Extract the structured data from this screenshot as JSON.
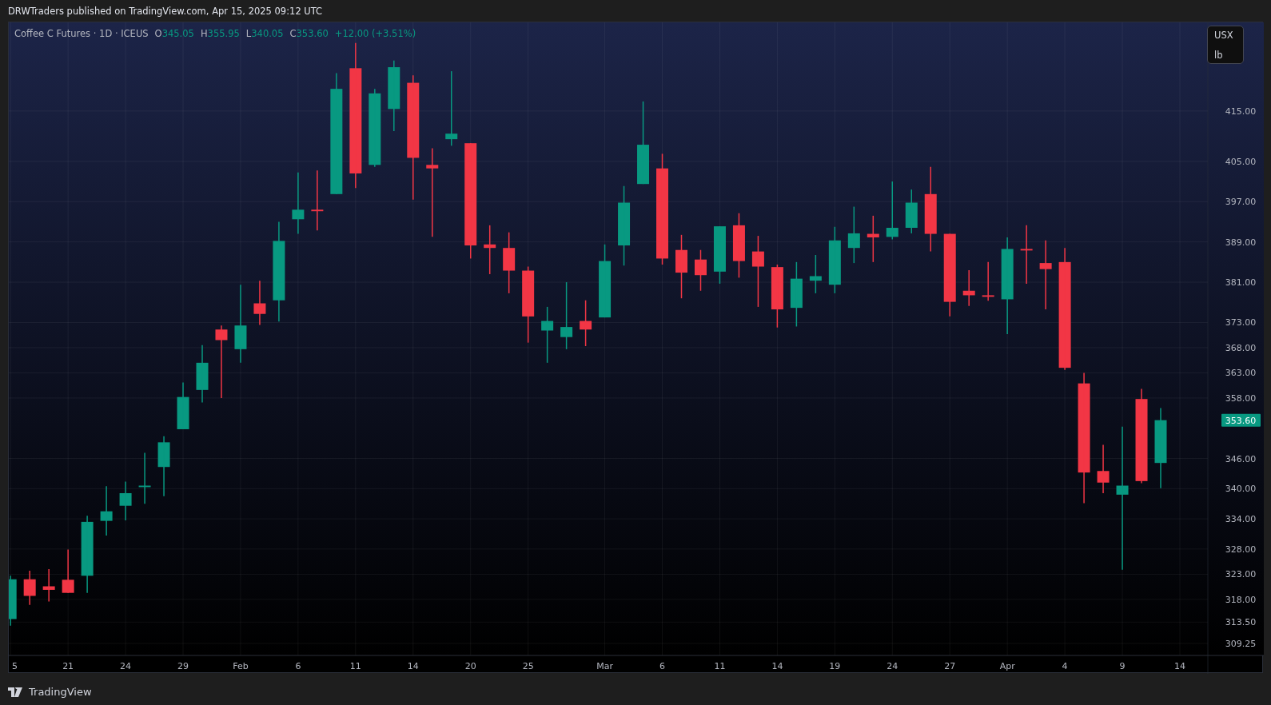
{
  "header": {
    "title": "DRWTraders published on TradingView.com, Apr 15, 2025 09:12 UTC"
  },
  "legend": {
    "symbol": "Coffee C Futures · 1D · ICEUS",
    "ohlc": [
      {
        "label": "O",
        "value": "345.05"
      },
      {
        "label": "H",
        "value": "355.95"
      },
      {
        "label": "L",
        "value": "340.05"
      },
      {
        "label": "C",
        "value": "353.60"
      }
    ],
    "change": "+12.00 (+3.51%)"
  },
  "units": [
    "USX",
    "lb"
  ],
  "last_price": "353.60",
  "chart": {
    "chart_data": {
      "type": "candlestick",
      "grid": true,
      "ylim": [
        306.87,
        432.6
      ],
      "categories": [
        "5",
        null,
        null,
        "21",
        null,
        null,
        "24",
        null,
        null,
        "29",
        null,
        null,
        "Feb",
        null,
        null,
        "6",
        null,
        null,
        "11",
        null,
        null,
        "14",
        null,
        null,
        "20",
        null,
        null,
        "25",
        null,
        null,
        null,
        "Mar",
        null,
        null,
        "6",
        null,
        null,
        "11",
        null,
        null,
        "14",
        null,
        null,
        "19",
        null,
        null,
        "24",
        null,
        null,
        "27",
        null,
        null,
        "Apr",
        null,
        null,
        "4",
        null,
        null,
        "9",
        null,
        null,
        "14"
      ],
      "yticks": [
        {
          "value": 415,
          "label": "415.00"
        },
        {
          "value": 405,
          "label": "405.00"
        },
        {
          "value": 397,
          "label": "397.00"
        },
        {
          "value": 389,
          "label": "389.00"
        },
        {
          "value": 381,
          "label": "381.00"
        },
        {
          "value": 373,
          "label": "373.00"
        },
        {
          "value": 368,
          "label": "368.00"
        },
        {
          "value": 363,
          "label": "363.00"
        },
        {
          "value": 358,
          "label": "358.00"
        },
        {
          "value": 346,
          "label": "346.00"
        },
        {
          "value": 340,
          "label": "340.00"
        },
        {
          "value": 334,
          "label": "334.00"
        },
        {
          "value": 328,
          "label": "328.00"
        },
        {
          "value": 323,
          "label": "323.00"
        },
        {
          "value": 318,
          "label": "318.00"
        },
        {
          "value": 313.5,
          "label": "313.50"
        },
        {
          "value": 309.25,
          "label": "309.25"
        }
      ],
      "ohlc": [
        [
          314.1,
          322.7,
          312.8,
          322.0
        ],
        [
          322.0,
          323.7,
          316.9,
          318.7
        ],
        [
          320.6,
          324.0,
          317.6,
          319.9
        ],
        [
          321.9,
          327.9,
          319.3,
          319.3
        ],
        [
          322.7,
          334.6,
          319.3,
          333.4
        ],
        [
          333.6,
          340.5,
          330.7,
          335.5
        ],
        [
          336.6,
          341.4,
          333.7,
          339.1
        ],
        [
          340.3,
          347.1,
          337.0,
          340.6
        ],
        [
          344.3,
          350.4,
          338.5,
          349.2
        ],
        [
          351.8,
          361.1,
          351.8,
          358.2
        ],
        [
          359.6,
          368.5,
          357.1,
          365.0
        ],
        [
          371.6,
          372.4,
          358.0,
          369.5
        ],
        [
          367.7,
          380.5,
          365.0,
          372.4
        ],
        [
          376.8,
          381.3,
          372.5,
          374.7
        ],
        [
          377.4,
          393.0,
          373.2,
          389.2
        ],
        [
          393.5,
          402.8,
          390.6,
          395.4
        ],
        [
          395.4,
          403.2,
          391.3,
          395.1
        ],
        [
          398.5,
          422.5,
          398.5,
          419.4
        ],
        [
          423.5,
          428.5,
          399.7,
          402.6
        ],
        [
          404.3,
          419.4,
          403.9,
          418.5
        ],
        [
          415.4,
          425.0,
          411.0,
          423.7
        ],
        [
          420.6,
          422.1,
          397.4,
          405.7
        ],
        [
          404.3,
          407.6,
          390.0,
          403.6
        ],
        [
          409.4,
          422.9,
          408.1,
          410.5
        ],
        [
          408.6,
          408.6,
          385.7,
          388.3
        ],
        [
          388.5,
          392.3,
          382.6,
          387.8
        ],
        [
          387.8,
          390.9,
          378.8,
          383.3
        ],
        [
          383.3,
          384.1,
          369.0,
          374.2
        ],
        [
          371.4,
          376.1,
          365.0,
          373.3
        ],
        [
          370.1,
          381.0,
          367.7,
          372.1
        ],
        [
          373.3,
          377.4,
          368.3,
          371.6
        ],
        [
          374.0,
          388.5,
          374.0,
          385.2
        ],
        [
          388.3,
          400.1,
          384.3,
          396.8
        ],
        [
          400.5,
          416.9,
          400.5,
          408.3
        ],
        [
          403.6,
          406.5,
          384.5,
          385.7
        ],
        [
          387.4,
          390.4,
          377.8,
          382.9
        ],
        [
          385.5,
          387.4,
          379.3,
          382.4
        ],
        [
          383.1,
          392.1,
          380.7,
          392.1
        ],
        [
          392.3,
          394.7,
          381.9,
          385.2
        ],
        [
          387.1,
          390.2,
          376.1,
          384.1
        ],
        [
          384.0,
          384.5,
          372.0,
          375.6
        ],
        [
          375.9,
          385.0,
          372.2,
          381.7
        ],
        [
          381.3,
          386.4,
          378.8,
          382.2
        ],
        [
          380.5,
          392.0,
          378.8,
          389.3
        ],
        [
          387.8,
          396.0,
          384.8,
          390.7
        ],
        [
          390.6,
          394.2,
          385.0,
          389.9
        ],
        [
          390.0,
          401.0,
          389.5,
          391.8
        ],
        [
          391.8,
          399.4,
          390.7,
          396.8
        ],
        [
          398.5,
          403.9,
          387.1,
          390.6
        ],
        [
          390.6,
          390.6,
          374.2,
          377.1
        ],
        [
          379.3,
          383.4,
          376.3,
          378.4
        ],
        [
          378.4,
          385.0,
          377.3,
          378.1
        ],
        [
          377.6,
          389.9,
          370.7,
          387.6
        ],
        [
          387.6,
          392.3,
          380.7,
          387.3
        ],
        [
          384.8,
          389.3,
          375.6,
          383.6
        ],
        [
          385.0,
          387.8,
          363.6,
          364.0
        ],
        [
          360.9,
          363.0,
          337.1,
          343.2
        ],
        [
          343.5,
          348.7,
          339.1,
          341.2
        ],
        [
          338.8,
          352.3,
          323.9,
          340.6
        ],
        [
          357.8,
          359.8,
          341.1,
          341.5
        ],
        [
          345.1,
          356.0,
          340.1,
          353.6
        ],
        null
      ]
    }
  },
  "footer": {
    "brand": "TradingView"
  }
}
